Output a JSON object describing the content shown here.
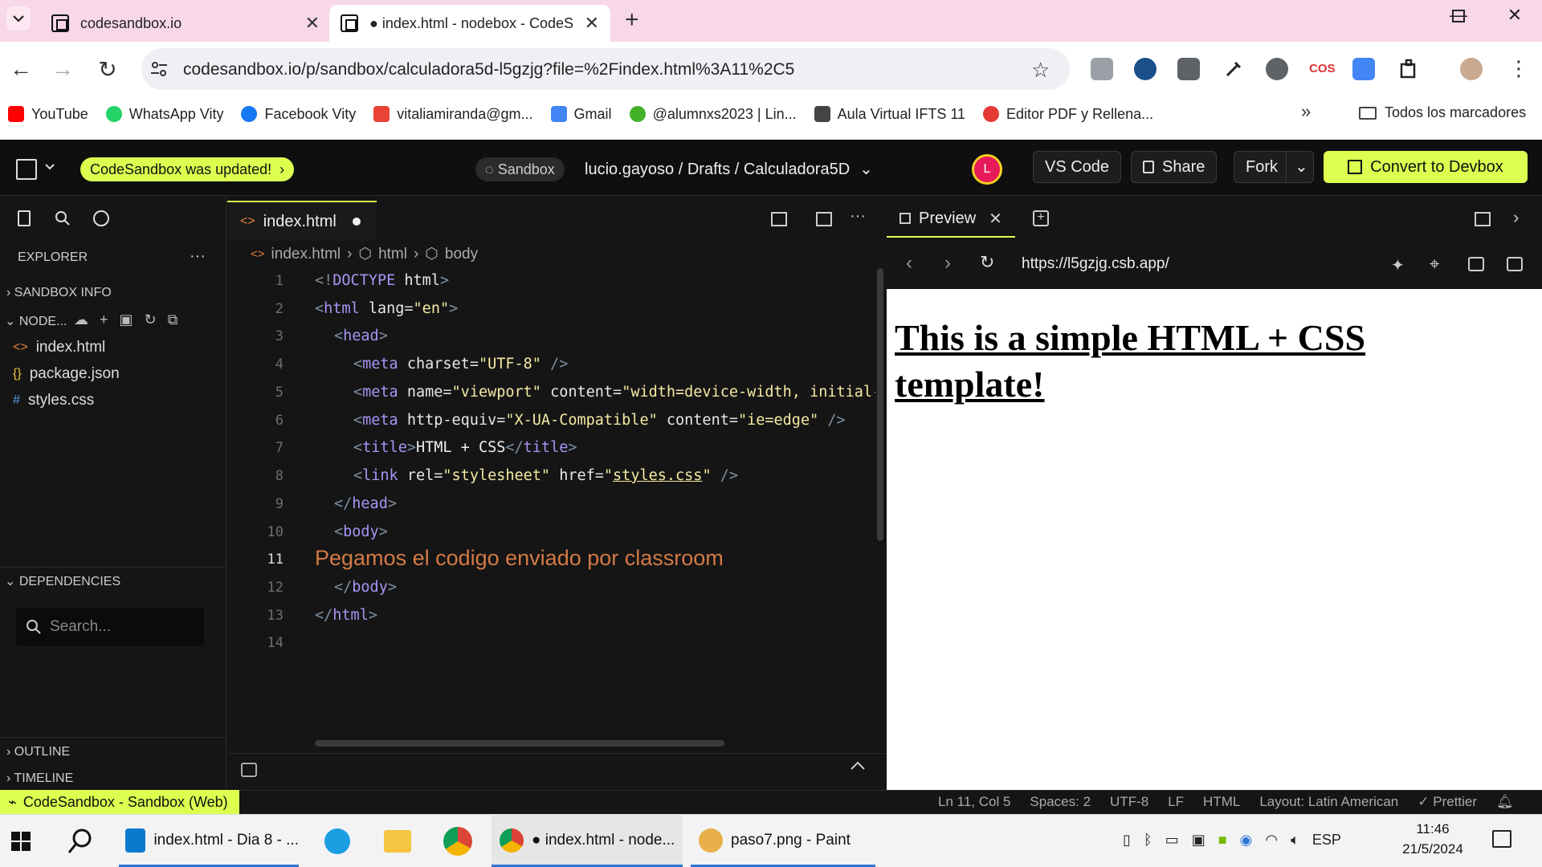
{
  "browser": {
    "tabs": [
      {
        "title": "codesandbox.io"
      },
      {
        "title": "● index.html - nodebox - CodeSandbox"
      }
    ],
    "url": "codesandbox.io/p/sandbox/calculadora5d-l5gzjg?file=%2Findex.html%3A11%2C5",
    "bookmarks": [
      {
        "label": "YouTube",
        "color": "#ff0000"
      },
      {
        "label": "WhatsApp Vity",
        "color": "#25d366"
      },
      {
        "label": "Facebook Vity",
        "color": "#1877f2"
      },
      {
        "label": "vitaliamiranda@gm...",
        "color": "#ea4335"
      },
      {
        "label": "Gmail",
        "color": "#4285f4"
      },
      {
        "label": "@alumnxs2023 | Lin...",
        "color": "#43b02a"
      },
      {
        "label": "Aula Virtual IFTS 11",
        "color": "#444444"
      },
      {
        "label": "Editor PDF y Rellena...",
        "color": "#e53935"
      }
    ],
    "all_bookmarks": "Todos los marcadores"
  },
  "topbar": {
    "updated": "CodeSandbox was updated!",
    "sandbox_label": "Sandbox",
    "breadcrumb": "lucio.gayoso / Drafts / Calculadora5D",
    "avatar_letter": "L",
    "vscode": "VS Code",
    "share": "Share",
    "fork": "Fork",
    "devbox": "Convert to Devbox"
  },
  "sidebar": {
    "explorer": "EXPLORER",
    "sandbox_info": "SANDBOX INFO",
    "nodebox": "NODE...",
    "files": [
      {
        "name": "index.html",
        "icon": "<>",
        "color": "#e8823c"
      },
      {
        "name": "package.json",
        "icon": "{}",
        "color": "#e8c93c"
      },
      {
        "name": "styles.css",
        "icon": "#",
        "color": "#4a9ee8"
      }
    ],
    "dependencies": "DEPENDENCIES",
    "search_placeholder": "Search...",
    "outline": "OUTLINE",
    "timeline": "TIMELINE"
  },
  "editor": {
    "tab": "index.html",
    "crumbs": [
      "index.html",
      "html",
      "body"
    ],
    "line_numbers": [
      "1",
      "2",
      "3",
      "4",
      "5",
      "6",
      "7",
      "8",
      "9",
      "10",
      "11",
      "12",
      "13",
      "14"
    ],
    "active_line": "11",
    "pasted_text": "Pegamos el codigo enviado por classroom"
  },
  "preview": {
    "tab": "Preview",
    "url": "https://l5gzjg.csb.app/",
    "heading": "This is a simple HTML + CSS template!"
  },
  "statusbar": {
    "left": "CodeSandbox - Sandbox (Web)",
    "position": "Ln 11, Col 5",
    "spaces": "Spaces: 2",
    "encoding": "UTF-8",
    "eol": "LF",
    "language": "HTML",
    "layout": "Layout: Latin American",
    "prettier": "Prettier"
  },
  "taskbar": {
    "vscode": "index.html - Dia 8 - ...",
    "chrome_window": "● index.html - node...",
    "paint": "paso7.png - Paint",
    "lang": "ESP",
    "time": "11:46",
    "date": "21/5/2024"
  }
}
